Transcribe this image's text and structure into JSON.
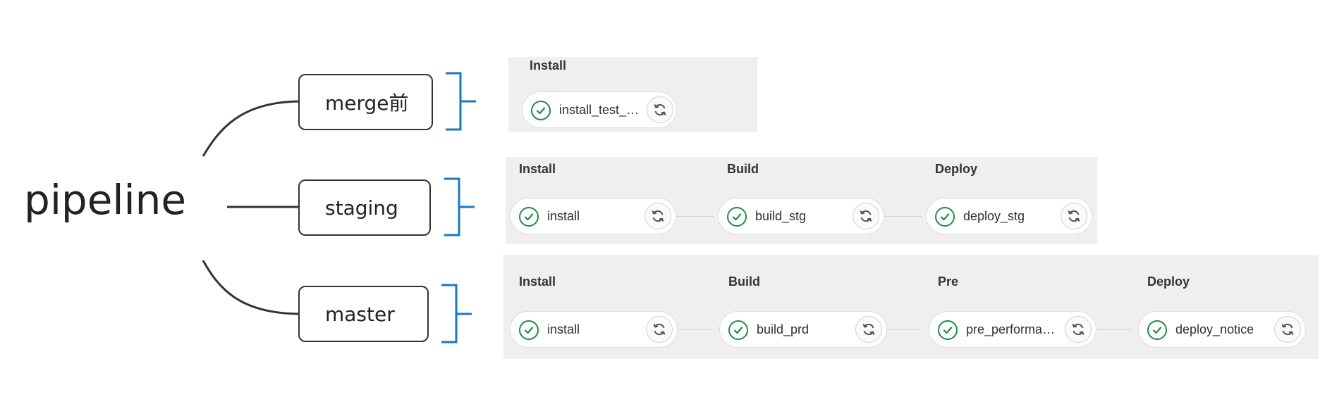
{
  "root": {
    "label": "pipeline"
  },
  "branches": [
    {
      "label": "merge前"
    },
    {
      "label": "staging"
    },
    {
      "label": "master"
    }
  ],
  "pipelines": [
    {
      "stages": [
        {
          "title": "Install",
          "job": "install_test_lint",
          "status": "success"
        }
      ]
    },
    {
      "stages": [
        {
          "title": "Install",
          "job": "install",
          "status": "success"
        },
        {
          "title": "Build",
          "job": "build_stg",
          "status": "success"
        },
        {
          "title": "Deploy",
          "job": "deploy_stg",
          "status": "success"
        }
      ]
    },
    {
      "stages": [
        {
          "title": "Install",
          "job": "install",
          "status": "success"
        },
        {
          "title": "Build",
          "job": "build_prd",
          "status": "success"
        },
        {
          "title": "Pre",
          "job": "pre_performance",
          "status": "success"
        },
        {
          "title": "Deploy",
          "job": "deploy_notice",
          "status": "success"
        }
      ]
    }
  ],
  "icons": {
    "status": "check-circle-icon",
    "retry": "retry-icon"
  },
  "colors": {
    "success": "#1f8b4c",
    "bracket": "#1a78c2",
    "connector": "#333333",
    "panel": "#efefef"
  }
}
